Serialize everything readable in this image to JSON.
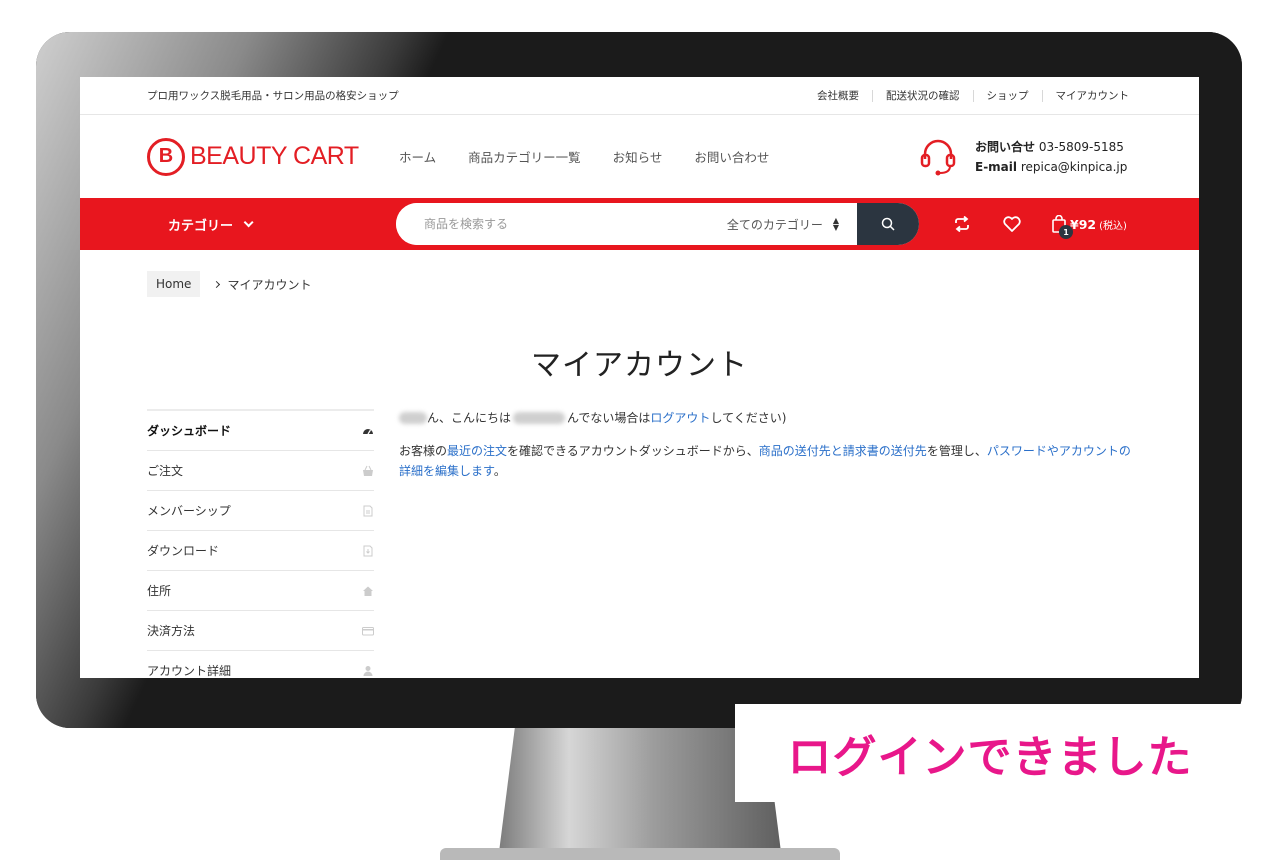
{
  "top_bar": {
    "tagline": "プロ用ワックス脱毛用品・サロン用品の格安ショップ",
    "links": [
      "会社概要",
      "配送状況の確認",
      "ショップ",
      "マイアカウント"
    ]
  },
  "header": {
    "logo_text": "BEAUTY CART",
    "nav": [
      "ホーム",
      "商品カテゴリー一覧",
      "お知らせ",
      "お問い合わせ"
    ],
    "contact": {
      "phone_label": "お問い合せ",
      "phone": "03-5809-5185",
      "email_label": "E-mail",
      "email": "repica@kinpica.jp"
    }
  },
  "red_nav": {
    "category_label": "カテゴリー",
    "search_placeholder": "商品を検索する",
    "search_category": "全てのカテゴリー",
    "cart_count": "1",
    "cart_price": "¥92",
    "cart_tax": "(税込)"
  },
  "breadcrumb": {
    "home": "Home",
    "current": "マイアカウント"
  },
  "page_title": "マイアカウント",
  "sidebar": {
    "items": [
      {
        "label": "ダッシュボード",
        "icon": "dashboard-icon"
      },
      {
        "label": "ご注文",
        "icon": "basket-icon"
      },
      {
        "label": "メンバーシップ",
        "icon": "document-icon"
      },
      {
        "label": "ダウンロード",
        "icon": "download-file-icon"
      },
      {
        "label": "住所",
        "icon": "home-icon"
      },
      {
        "label": "決済方法",
        "icon": "credit-card-icon"
      },
      {
        "label": "アカウント詳細",
        "icon": "user-icon"
      }
    ]
  },
  "content": {
    "greeting_part1": "ん、こんにちは",
    "greeting_part2": "んでない場合は",
    "logout_link": "ログアウト",
    "greeting_part3": "してください)",
    "desc_prefix": "お客様の",
    "recent_orders_link": "最近の注文",
    "desc_mid1": "を確認できるアカウントダッシュボードから、",
    "addresses_link": "商品の送付先と請求書の送付先",
    "desc_mid2": "を管理し、",
    "account_link": "パスワードやアカウントの詳細を編集します",
    "desc_suffix": "。"
  },
  "caption": "ログインできました",
  "colors": {
    "brand_red": "#e8161e",
    "caption_pink": "#e8178a",
    "link_blue": "#2a6fc9",
    "dark_button": "#2b3540"
  }
}
